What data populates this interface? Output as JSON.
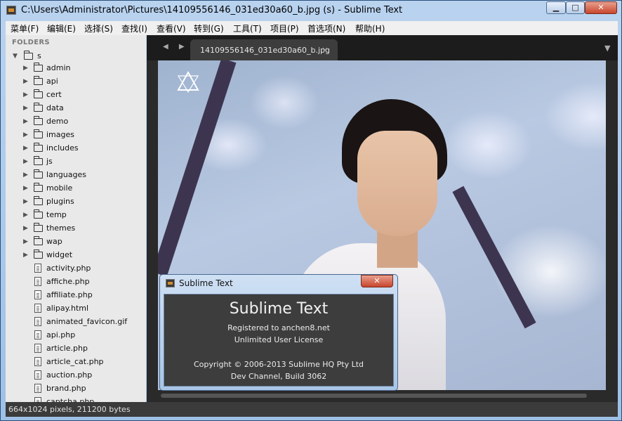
{
  "window": {
    "title": "C:\\Users\\Administrator\\Pictures\\14109556146_031ed30a60_b.jpg (s) - Sublime Text",
    "min_label": "▁",
    "max_label": "□",
    "close_label": "✕"
  },
  "menu": [
    {
      "label": "菜单(F)"
    },
    {
      "label": "编辑(E)"
    },
    {
      "label": "选择(S)"
    },
    {
      "label": "查找(I)"
    },
    {
      "label": "查看(V)"
    },
    {
      "label": "转到(G)"
    },
    {
      "label": "工具(T)"
    },
    {
      "label": "项目(P)"
    },
    {
      "label": "首选项(N)"
    },
    {
      "label": "帮助(H)"
    }
  ],
  "sidebar": {
    "header": "FOLDERS",
    "root": "s",
    "folders": [
      "admin",
      "api",
      "cert",
      "data",
      "demo",
      "images",
      "includes",
      "js",
      "languages",
      "mobile",
      "plugins",
      "temp",
      "themes",
      "wap",
      "widget"
    ],
    "files": [
      "activity.php",
      "affiche.php",
      "affiliate.php",
      "alipay.html",
      "animated_favicon.gif",
      "api.php",
      "article.php",
      "article_cat.php",
      "auction.php",
      "brand.php",
      "captcha.php"
    ]
  },
  "tabs": [
    {
      "label": "14109556146_031ed30a60_b.jpg",
      "close": "×"
    }
  ],
  "about": {
    "title": "Sublime Text",
    "close_label": "✕",
    "app_name": "Sublime Text",
    "registered": "Registered to anchen8.net",
    "license": "Unlimited User License",
    "copyright": "Copyright © 2006-2013 Sublime HQ Pty Ltd",
    "build": "Dev Channel, Build 3062"
  },
  "status": {
    "text": "664x1024 pixels, 211200 bytes"
  },
  "colors": {
    "sidebar_bg": "#e9e9e9",
    "editor_bg": "#2a2a2a",
    "status_bg": "#3b3b3b"
  }
}
